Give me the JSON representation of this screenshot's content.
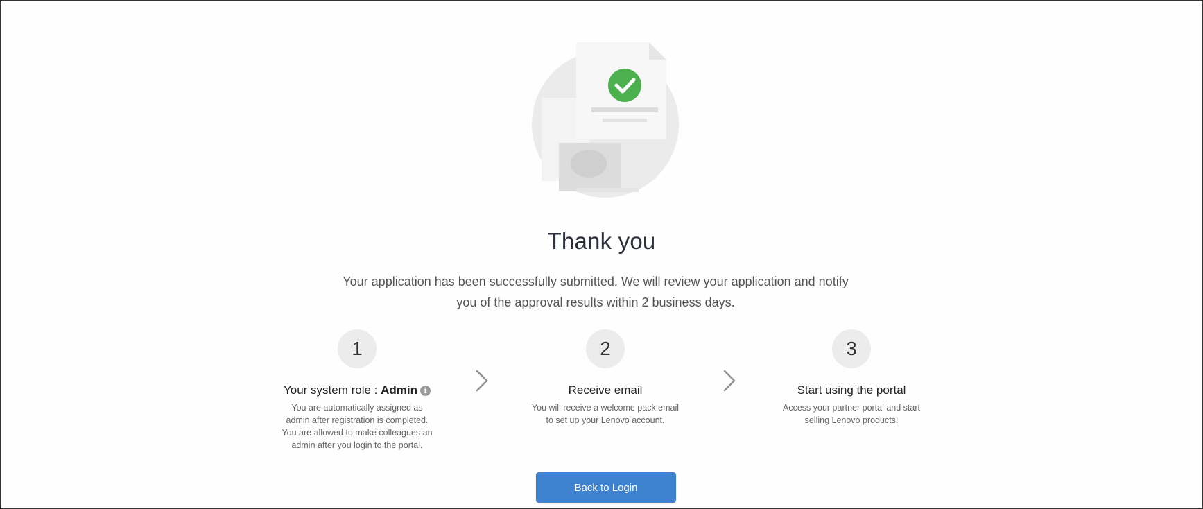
{
  "main": {
    "title": "Thank you",
    "subtitle_line1": "Your application has been successfully submitted. We will review your application and notify",
    "subtitle_line2": "you of the approval results within 2 business days."
  },
  "steps": [
    {
      "number": "1",
      "title_prefix": "Your system role : ",
      "title_bold": "Admin",
      "desc_lines": [
        "You are automatically assigned as",
        "admin after registration is completed.",
        "You are allowed to make colleagues an",
        "admin after you login to the portal."
      ]
    },
    {
      "number": "2",
      "title": "Receive email",
      "desc_lines": [
        "You will receive a welcome pack email",
        "to set up your Lenovo account."
      ]
    },
    {
      "number": "3",
      "title": "Start using the portal",
      "desc_lines": [
        "Access your partner portal and start",
        "selling Lenovo products!"
      ]
    }
  ],
  "icons": {
    "success": "check-circle-icon",
    "info": "info-icon",
    "arrow": "chevron-right-icon"
  },
  "colors": {
    "success_green": "#4cb04f",
    "button_blue": "#3f82cf",
    "step_circle": "#ececec"
  },
  "actions": {
    "back_to_login": "Back to Login"
  }
}
